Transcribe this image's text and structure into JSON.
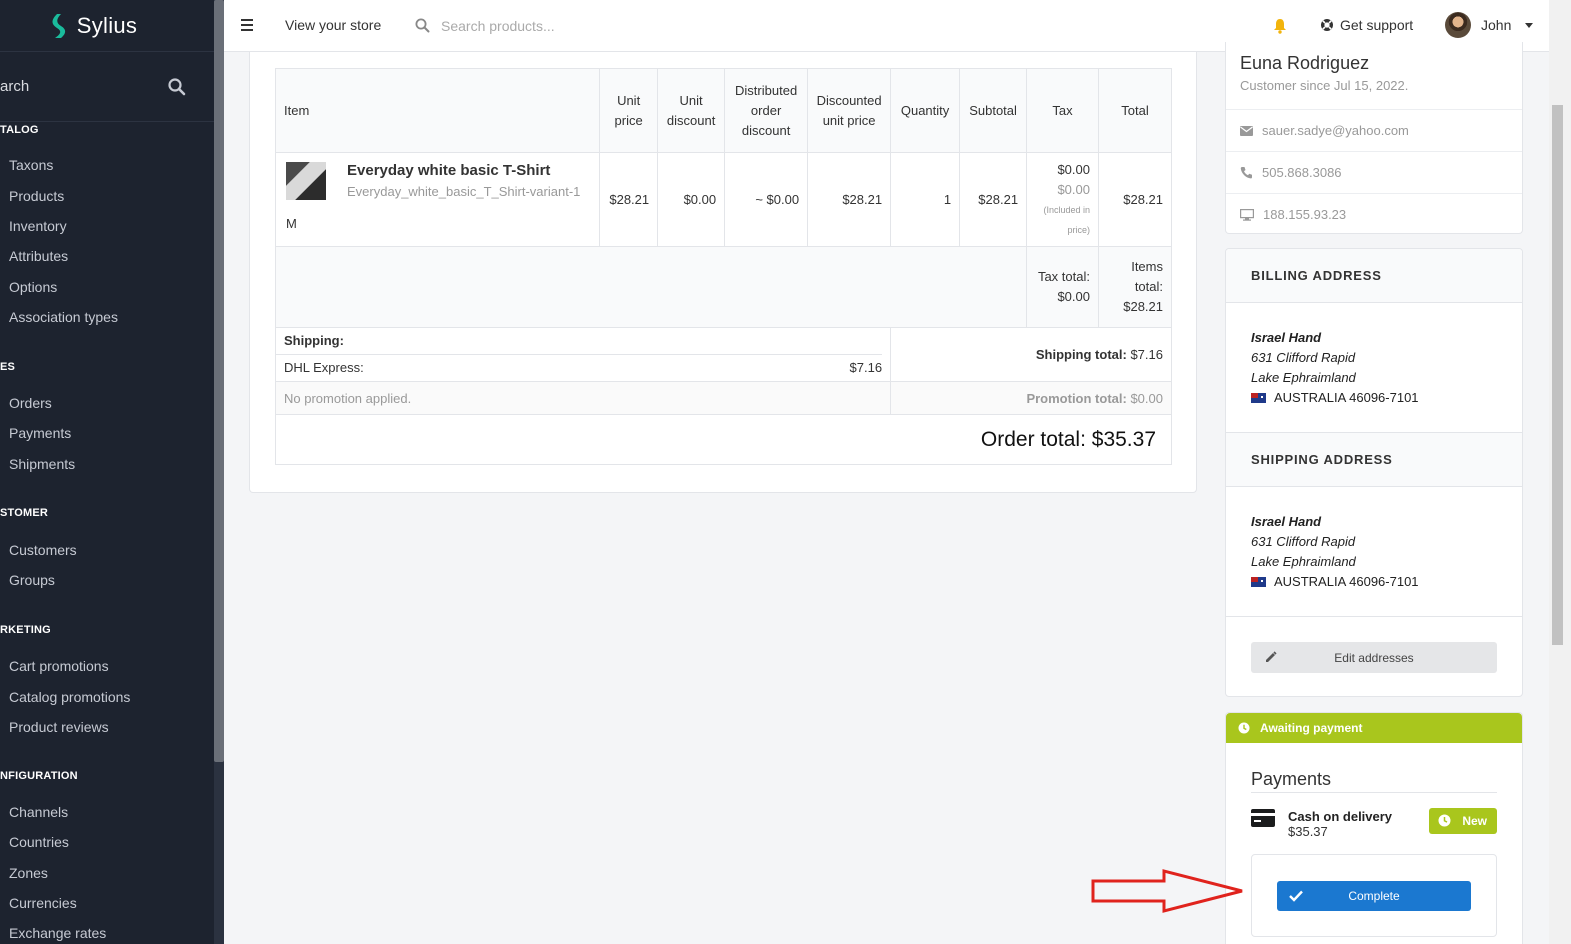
{
  "app": {
    "name": "Sylius"
  },
  "sidebar": {
    "search_label": "arch",
    "sections": [
      {
        "title": "TALOG",
        "items": [
          "Taxons",
          "Products",
          "Inventory",
          "Attributes",
          "Options",
          "Association types"
        ]
      },
      {
        "title": "ES",
        "items": [
          "Orders",
          "Payments",
          "Shipments"
        ]
      },
      {
        "title": "STOMER",
        "items": [
          "Customers",
          "Groups"
        ]
      },
      {
        "title": "RKETING",
        "items": [
          "Cart promotions",
          "Catalog promotions",
          "Product reviews"
        ]
      },
      {
        "title": "NFIGURATION",
        "items": [
          "Channels",
          "Countries",
          "Zones",
          "Currencies",
          "Exchange rates"
        ]
      }
    ]
  },
  "topbar": {
    "store_link": "View your store",
    "search_placeholder": "Search products...",
    "support": "Get support",
    "user": "John"
  },
  "order": {
    "headers": [
      "Item",
      "Unit price",
      "Unit discount",
      "Distributed order discount",
      "Discounted unit price",
      "Quantity",
      "Subtotal",
      "Tax",
      "Total"
    ],
    "item": {
      "name": "Everyday white basic T-Shirt",
      "variant": "Everyday_white_basic_T_Shirt-variant-1",
      "size": "M",
      "unit_price": "$28.21",
      "unit_discount": "$0.00",
      "distributed_discount": "~ $0.00",
      "discounted_unit_price": "$28.21",
      "quantity": "1",
      "subtotal": "$28.21",
      "tax": "$0.00",
      "tax_included": "$0.00",
      "tax_included_note_1": "(Included in",
      "tax_included_note_2": "price)",
      "total": "$28.21"
    },
    "tax_total_label": "Tax total:",
    "tax_total": "$0.00",
    "items_total_label_1": "Items",
    "items_total_label_2": "total:",
    "items_total": "$28.21",
    "shipping_label": "Shipping:",
    "shipping_method": "DHL Express:",
    "shipping_method_amount": "$7.16",
    "shipping_total_label": "Shipping total:",
    "shipping_total": "$7.16",
    "promotion_text": "No promotion applied.",
    "promotion_total_label": "Promotion total:",
    "promotion_total": "$0.00",
    "order_total": "Order total: $35.37"
  },
  "customer": {
    "name": "Euna Rodriguez",
    "since": "Customer since Jul 15, 2022.",
    "email": "sauer.sadye@yahoo.com",
    "phone": "505.868.3086",
    "ip": "188.155.93.23"
  },
  "billing": {
    "title": "BILLING ADDRESS",
    "name": "Israel Hand",
    "street": "631 Clifford Rapid",
    "city": "Lake Ephraimland",
    "country": "AUSTRALIA 46096-7101"
  },
  "shipping": {
    "title": "SHIPPING ADDRESS",
    "name": "Israel Hand",
    "street": "631 Clifford Rapid",
    "city": "Lake Ephraimland",
    "country": "AUSTRALIA 46096-7101"
  },
  "edit_addresses": "Edit addresses",
  "payment": {
    "status": "Awaiting payment",
    "title": "Payments",
    "method": "Cash on delivery",
    "amount": "$35.37",
    "state": "New",
    "complete_button": "Complete"
  },
  "colors": {
    "sidebar_bg": "#1d232f",
    "accent_green": "#a9c61d",
    "primary_blue": "#1b78d0",
    "annotation_red": "#e0231d"
  }
}
